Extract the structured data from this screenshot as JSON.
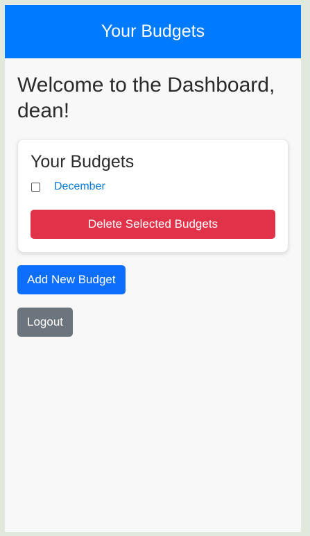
{
  "header": {
    "title": "Your Budgets"
  },
  "welcome": "Welcome to the Dashboard, dean!",
  "card": {
    "title": "Your Budgets",
    "budgets": [
      {
        "name": "December",
        "checked": false
      }
    ],
    "delete_label": "Delete Selected Budgets"
  },
  "actions": {
    "add_label": "Add New Budget",
    "logout_label": "Logout"
  }
}
